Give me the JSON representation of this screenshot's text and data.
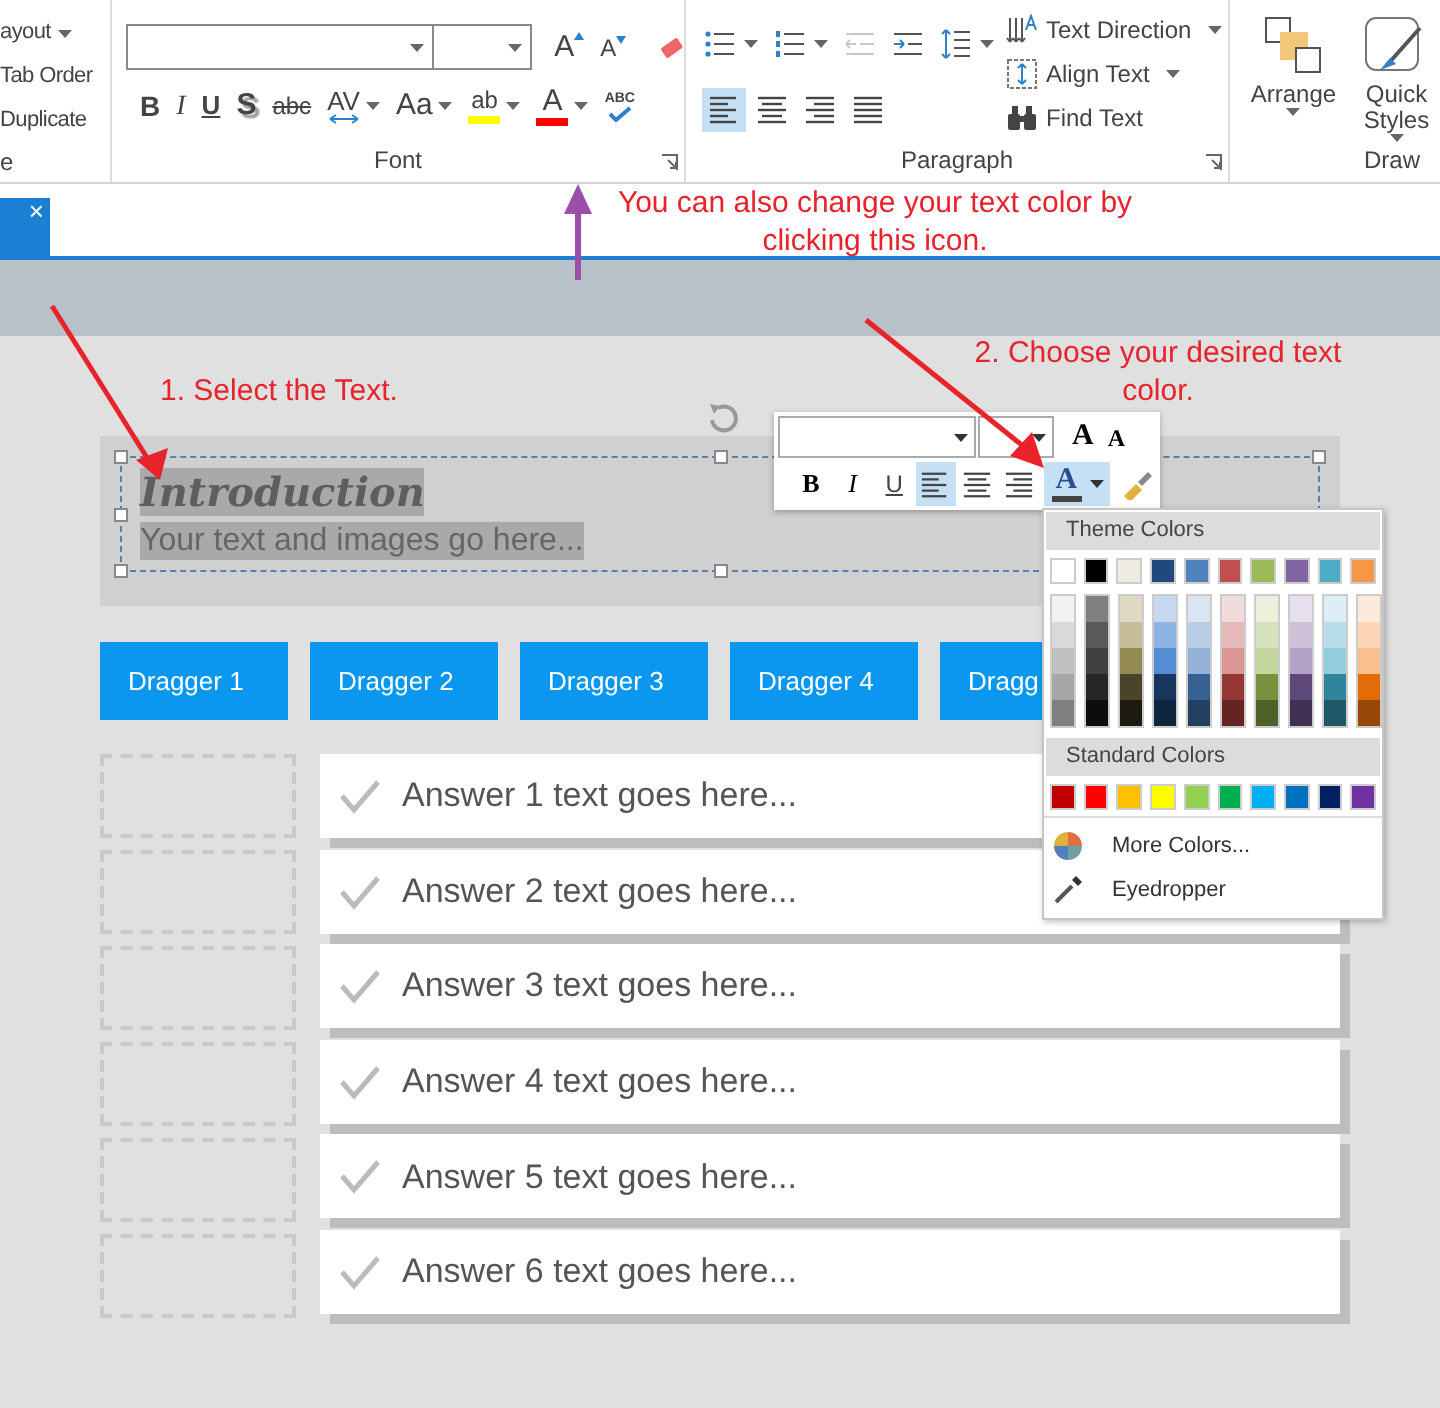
{
  "ribbon": {
    "left_group": {
      "items": [
        {
          "label": "ayout",
          "dropdown": true
        },
        {
          "label": "Tab Order",
          "dropdown": false
        },
        {
          "label": "Duplicate",
          "dropdown": false
        }
      ],
      "label": "e"
    },
    "font_group": {
      "label": "Font",
      "grow": "A",
      "shrink": "A",
      "buttons": [
        {
          "label": "B",
          "kind": "bold",
          "dropdown": false
        },
        {
          "label": "I",
          "kind": "italic",
          "dropdown": false
        },
        {
          "label": "U",
          "kind": "underline",
          "dropdown": false
        },
        {
          "label": "S",
          "kind": "shadow",
          "dropdown": false
        },
        {
          "label": "abc",
          "kind": "strike",
          "dropdown": false
        },
        {
          "label": "AV",
          "kind": "spacing",
          "dropdown": true
        },
        {
          "label": "Aa",
          "kind": "case",
          "dropdown": true
        },
        {
          "label": "ab",
          "kind": "highlight",
          "dropdown": true
        },
        {
          "label": "A",
          "kind": "color",
          "dropdown": true
        },
        {
          "label": "ABC",
          "kind": "spell",
          "dropdown": false
        }
      ]
    },
    "paragraph_group": {
      "label": "Paragraph",
      "list_buttons": [
        {
          "kind": "bullets",
          "dropdown": true,
          "disabled": false
        },
        {
          "kind": "numbering",
          "dropdown": true,
          "disabled": false
        },
        {
          "kind": "outdent",
          "dropdown": false,
          "disabled": true
        },
        {
          "kind": "indent",
          "dropdown": false,
          "disabled": false
        },
        {
          "kind": "spacing",
          "dropdown": true,
          "disabled": false
        }
      ],
      "align_buttons": [
        {
          "kind": "left",
          "selected": true
        },
        {
          "kind": "center",
          "selected": false
        },
        {
          "kind": "right",
          "selected": false
        },
        {
          "kind": "justify",
          "selected": false
        }
      ],
      "commands": [
        {
          "label": "Text Direction",
          "kind": "direction",
          "dropdown": true
        },
        {
          "label": "Align Text",
          "kind": "align",
          "dropdown": true
        },
        {
          "label": "Find Text",
          "kind": "find",
          "dropdown": false
        }
      ]
    },
    "draw_group": {
      "label": "Draw",
      "commands": [
        {
          "label": "Arrange",
          "kind": "arrange"
        },
        {
          "label": "Quick Styles",
          "kind": "styles"
        }
      ]
    }
  },
  "document_tab": {
    "close": "×"
  },
  "text_box": {
    "title": "Introduction",
    "body": "Your text and images go here..."
  },
  "draggers": [
    {
      "label": "Dragger 1"
    },
    {
      "label": "Dragger 2"
    },
    {
      "label": "Dragger 3"
    },
    {
      "label": "Dragger 4"
    },
    {
      "label": "Dragg"
    }
  ],
  "answers": [
    {
      "text": "Answer 1 text goes here..."
    },
    {
      "text": "Answer 2 text goes here..."
    },
    {
      "text": "Answer 3 text goes here..."
    },
    {
      "text": "Answer 4 text goes here..."
    },
    {
      "text": "Answer 5 text goes here..."
    },
    {
      "text": "Answer 6 text goes here..."
    }
  ],
  "mini_toolbar": {
    "grow": "A",
    "shrink": "A",
    "buttons": [
      {
        "label": "B",
        "kind": "bold",
        "selected": false
      },
      {
        "label": "I",
        "kind": "italic",
        "selected": false
      },
      {
        "label": "U",
        "kind": "underline",
        "selected": false
      },
      {
        "kind": "left",
        "selected": true
      },
      {
        "kind": "center",
        "selected": false
      },
      {
        "kind": "right",
        "selected": false
      },
      {
        "label": "A",
        "kind": "color",
        "selected": true
      },
      {
        "kind": "painter",
        "selected": false
      }
    ]
  },
  "color_menu": {
    "theme_title": "Theme Colors",
    "theme_colors": [
      {
        "color": "#ffffff",
        "shades": [
          {
            "color": "#f2f2f2"
          },
          {
            "color": "#d9d9d9"
          },
          {
            "color": "#bfbfbf"
          },
          {
            "color": "#a6a6a6"
          },
          {
            "color": "#808080"
          }
        ]
      },
      {
        "color": "#000000",
        "shades": [
          {
            "color": "#7f7f7f"
          },
          {
            "color": "#595959"
          },
          {
            "color": "#404040"
          },
          {
            "color": "#262626"
          },
          {
            "color": "#0d0d0d"
          }
        ]
      },
      {
        "color": "#eeece1",
        "shades": [
          {
            "color": "#ddd9c3"
          },
          {
            "color": "#c4bd97"
          },
          {
            "color": "#948a54"
          },
          {
            "color": "#4a452a"
          },
          {
            "color": "#1d1b10"
          }
        ]
      },
      {
        "color": "#1f497d",
        "shades": [
          {
            "color": "#c6d9f0"
          },
          {
            "color": "#8db3e2"
          },
          {
            "color": "#548dd4"
          },
          {
            "color": "#17365d"
          },
          {
            "color": "#0f243e"
          }
        ]
      },
      {
        "color": "#4f81bd",
        "shades": [
          {
            "color": "#dbe5f1"
          },
          {
            "color": "#b8cce4"
          },
          {
            "color": "#95b3d7"
          },
          {
            "color": "#366092"
          },
          {
            "color": "#244061"
          }
        ]
      },
      {
        "color": "#c0504d",
        "shades": [
          {
            "color": "#f2dcdb"
          },
          {
            "color": "#e5b9b7"
          },
          {
            "color": "#d99694"
          },
          {
            "color": "#953734"
          },
          {
            "color": "#632423"
          }
        ]
      },
      {
        "color": "#9bbb59",
        "shades": [
          {
            "color": "#ebf1dd"
          },
          {
            "color": "#d7e3bc"
          },
          {
            "color": "#c3d69b"
          },
          {
            "color": "#76923c"
          },
          {
            "color": "#4f6128"
          }
        ]
      },
      {
        "color": "#8064a2",
        "shades": [
          {
            "color": "#e5e0ec"
          },
          {
            "color": "#ccc1d9"
          },
          {
            "color": "#b2a2c7"
          },
          {
            "color": "#5f497a"
          },
          {
            "color": "#3f3151"
          }
        ]
      },
      {
        "color": "#4bacc6",
        "shades": [
          {
            "color": "#dbeef3"
          },
          {
            "color": "#b7dde8"
          },
          {
            "color": "#92cddc"
          },
          {
            "color": "#31859b"
          },
          {
            "color": "#205867"
          }
        ]
      },
      {
        "color": "#f79646",
        "shades": [
          {
            "color": "#fdeada"
          },
          {
            "color": "#fbd5b5"
          },
          {
            "color": "#fac08f"
          },
          {
            "color": "#e36c09"
          },
          {
            "color": "#974806"
          }
        ]
      }
    ],
    "standard_title": "Standard Colors",
    "standard_colors": [
      {
        "color": "#c00000"
      },
      {
        "color": "#ff0000"
      },
      {
        "color": "#ffc000"
      },
      {
        "color": "#ffff00"
      },
      {
        "color": "#92d050"
      },
      {
        "color": "#00b050"
      },
      {
        "color": "#00b0f0"
      },
      {
        "color": "#0070c0"
      },
      {
        "color": "#002060"
      },
      {
        "color": "#7030a0"
      }
    ],
    "items": [
      {
        "label": "More Colors...",
        "kind": "more"
      },
      {
        "label": "Eyedropper",
        "kind": "eyedropper"
      }
    ]
  },
  "annotations": [
    {
      "text": "You can also change your text color by clicking this icon.",
      "kind": "top"
    },
    {
      "text": "1. Select the Text.",
      "kind": "left"
    },
    {
      "text": "2. Choose your desired text color.",
      "kind": "right"
    }
  ]
}
